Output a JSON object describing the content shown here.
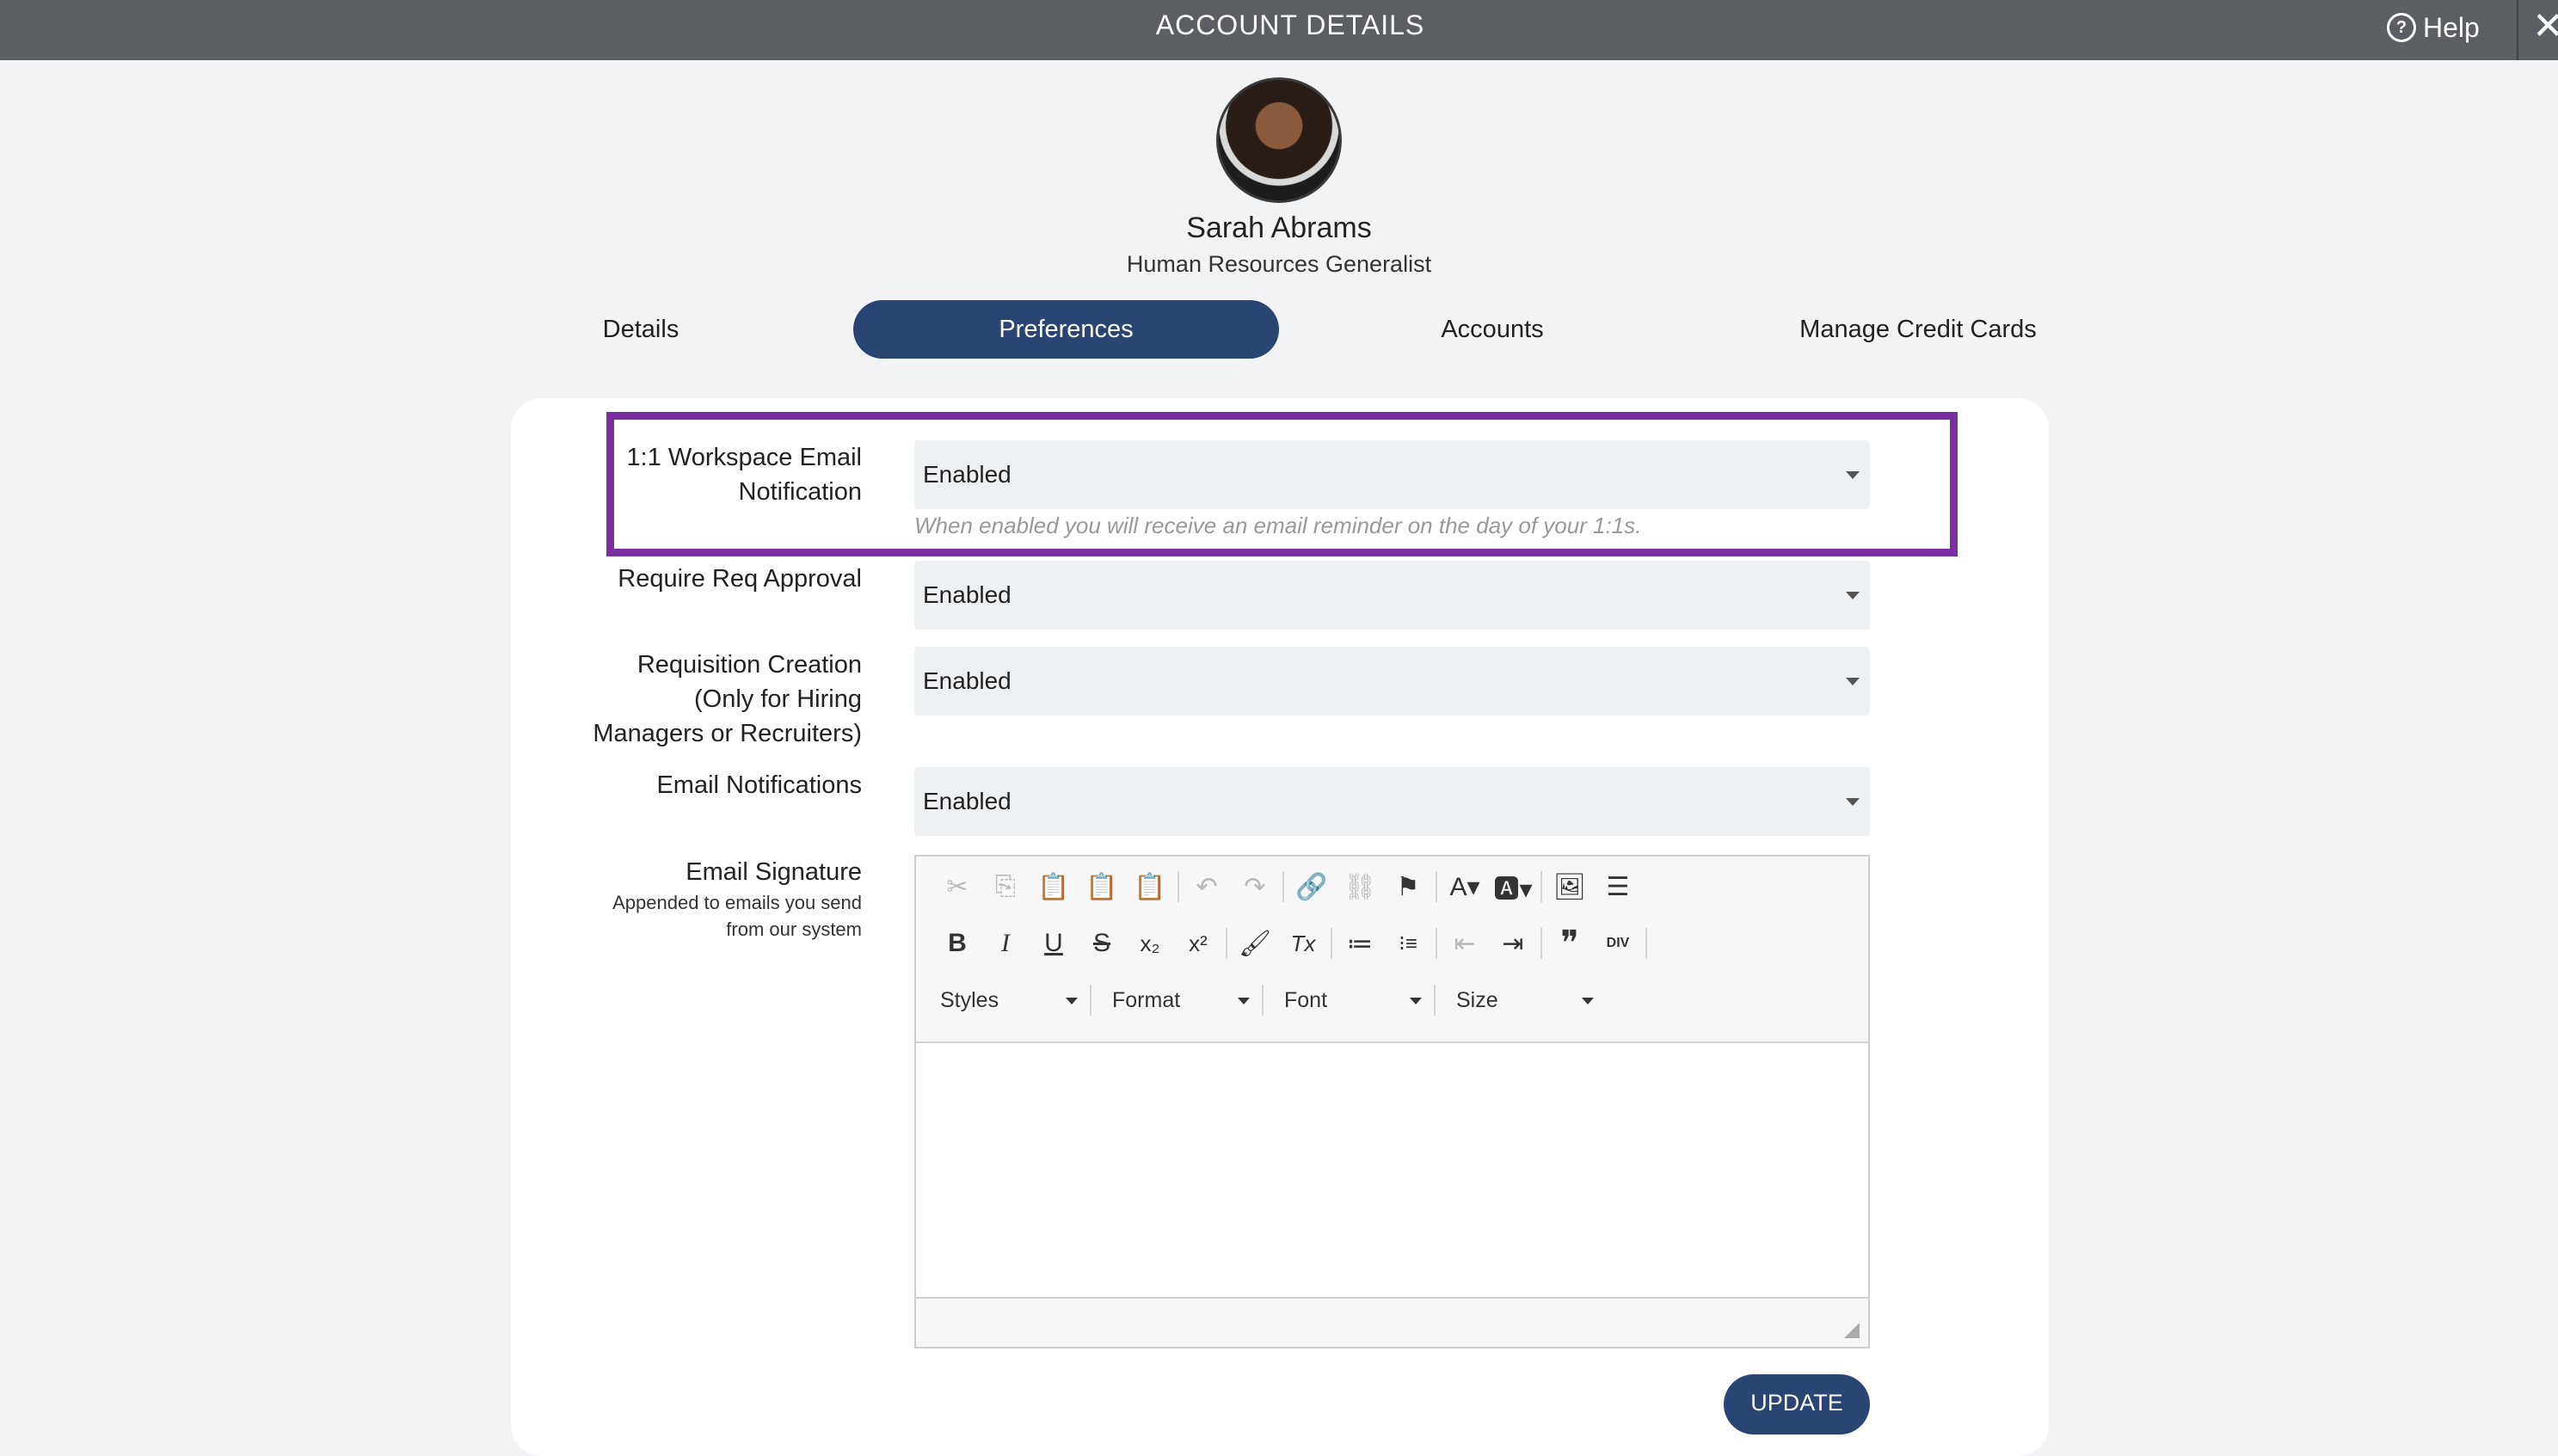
{
  "header": {
    "title": "ACCOUNT DETAILS",
    "help_label": "Help",
    "help_icon": "?",
    "close_icon": "✕"
  },
  "profile": {
    "name": "Sarah Abrams",
    "role": "Human Resources Generalist"
  },
  "tabs": [
    {
      "label": "Details",
      "active": false
    },
    {
      "label": "Preferences",
      "active": true
    },
    {
      "label": "Accounts",
      "active": false
    },
    {
      "label": "Manage Credit Cards",
      "active": false
    }
  ],
  "preferences": {
    "workspace_email": {
      "label": "1:1 Workspace Email Notification",
      "label_line1": "1:1 Workspace Email",
      "label_line2": "Notification",
      "value": "Enabled",
      "hint": "When enabled you will receive an email reminder on the day of your 1:1s."
    },
    "req_approval": {
      "label": "Require Req Approval",
      "value": "Enabled"
    },
    "req_creation": {
      "label_line1": "Requisition Creation",
      "label_line2": "(Only for Hiring",
      "label_line3": "Managers or Recruiters)",
      "value": "Enabled"
    },
    "email_notifications": {
      "label": "Email Notifications",
      "value": "Enabled"
    },
    "email_signature": {
      "label": "Email Signature",
      "sub_line1": "Appended to emails you send",
      "sub_line2": "from our system"
    }
  },
  "editor": {
    "combos": {
      "styles": "Styles",
      "format": "Format",
      "font": "Font",
      "size": "Size"
    },
    "glyphs": {
      "cut": "✂",
      "copy": "⎘",
      "paste": "📋",
      "paste_text": "📋",
      "paste_word": "📋",
      "undo": "↶",
      "redo": "↷",
      "link": "🔗",
      "unlink": "⛓",
      "anchor": "⚑",
      "text_color": "A▾",
      "bg_color": "🅰▾",
      "image": "🖼",
      "hr": "☰",
      "bold": "B",
      "italic": "I",
      "underline": "U",
      "strike": "S",
      "subscript": "x₂",
      "superscript": "x²",
      "copy_format": "🖌",
      "remove_format": "Tx",
      "numbered_list": "≔",
      "bullet_list": "⁝≡",
      "outdent": "⇤",
      "indent": "⇥",
      "blockquote": "❞",
      "div": "DIV"
    }
  },
  "actions": {
    "update_label": "UPDATE"
  },
  "colors": {
    "header_bg": "#5b5f63",
    "primary": "#2a4474",
    "highlight": "#7b2ea0",
    "field_bg": "#eef1f4"
  }
}
